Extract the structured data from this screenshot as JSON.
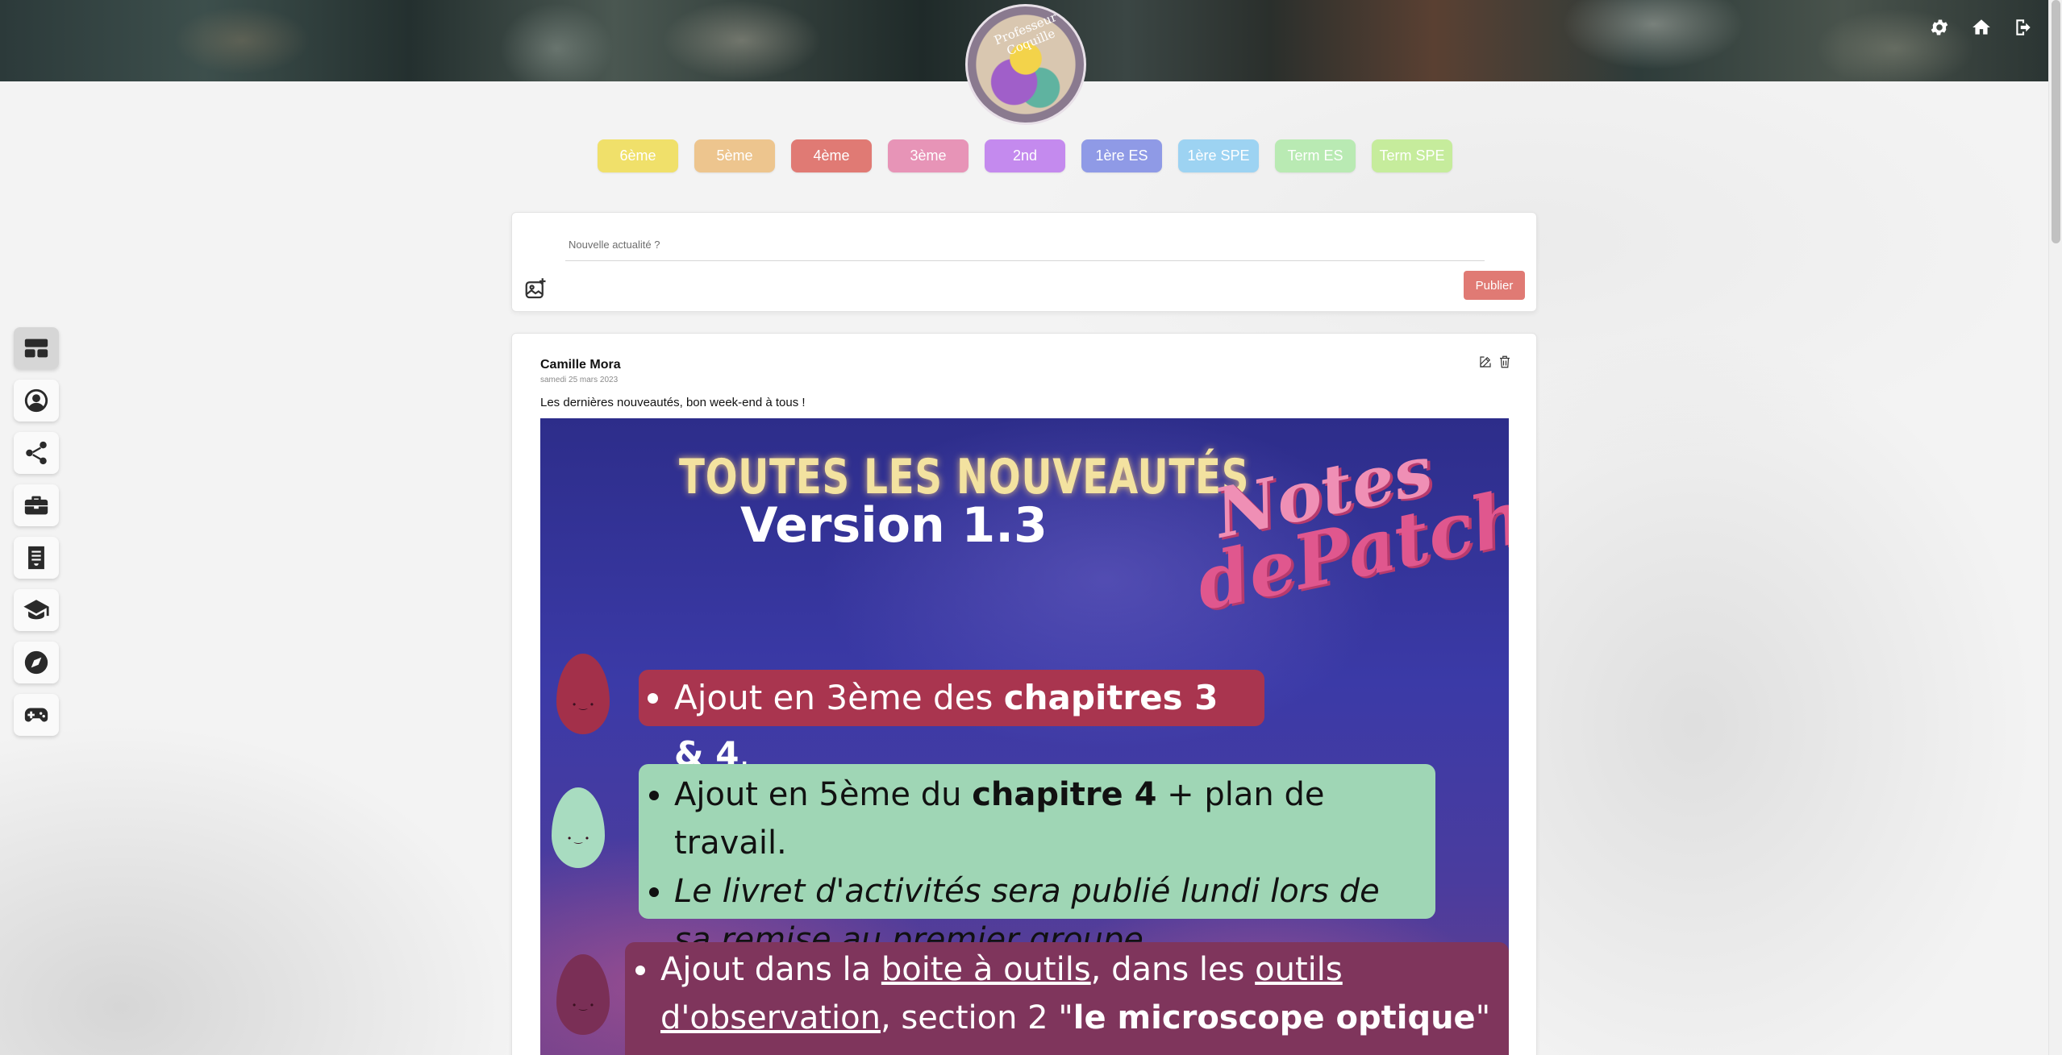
{
  "banner": {
    "avatar_text": "Professeur Coquille",
    "icons": [
      "gear-icon",
      "home-icon",
      "logout-icon"
    ]
  },
  "levels": [
    {
      "label": "6ème",
      "color": "#f0e06a"
    },
    {
      "label": "5ème",
      "color": "#edc58e"
    },
    {
      "label": "4ème",
      "color": "#e07a74"
    },
    {
      "label": "3ème",
      "color": "#e794b7"
    },
    {
      "label": "2nd",
      "color": "#c48aee"
    },
    {
      "label": "1ère ES",
      "color": "#8f9ae6"
    },
    {
      "label": "1ère SPE",
      "color": "#9dd3f2"
    },
    {
      "label": "Term ES",
      "color": "#b9eab3"
    },
    {
      "label": "Term SPE",
      "color": "#c6ec9c"
    }
  ],
  "sidenav": [
    "dashboard-icon",
    "user-icon",
    "share-icon",
    "toolbox-icon",
    "document-icon",
    "graduation-cap-icon",
    "compass-icon",
    "gamepad-icon"
  ],
  "composer": {
    "placeholder": "Nouvelle actualité ?",
    "publish_label": "Publier"
  },
  "post": {
    "author": "Camille Mora",
    "date": "samedi 25 mars 2023",
    "text": "Les dernières nouveautés, bon week-end à tous !",
    "image": {
      "title_line1": "TOUTES LES NOUVEAUTÉS",
      "title_line2": "Version 1.3",
      "badge_line1": "Notes",
      "badge_line2": "dePatch",
      "item1_prefix": "Ajout en 3ème des ",
      "item1_bold": "chapitres 3 & 4",
      "item1_suffix": ".",
      "item2_prefix": "Ajout en 5ème du ",
      "item2_bold": "chapitre 4",
      "item2_suffix": " + plan de travail.",
      "item2b": "Le livret d'activités sera publié lundi lors de sa remise au premier groupe.",
      "item3_prefix": "Ajout  dans la ",
      "item3_link1": "boite à outils",
      "item3_mid": ", dans les ",
      "item3_link2": "outils d'observation",
      "item3_mid2": ", section 2 \"",
      "item3_bold": "le microscope optique",
      "item3_suffix": "\" :"
    }
  }
}
